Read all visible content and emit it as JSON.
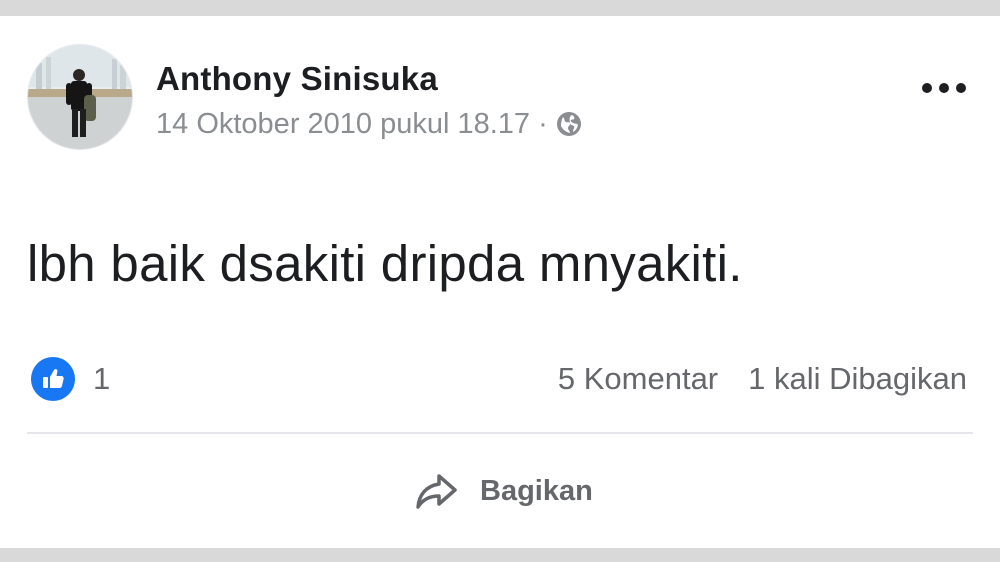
{
  "post": {
    "author": "Anthony Sinisuka",
    "date": "14 Oktober 2010 pukul 18.17",
    "separator": "·",
    "privacy_icon": "globe-icon",
    "text": "lbh baik dsakiti dripda mnyakiti."
  },
  "stats": {
    "reaction_icon": "like-icon",
    "reaction_count": "1",
    "comments": "5 Komentar",
    "shares": "1 kali Dibagikan"
  },
  "actions": {
    "share_icon": "share-arrow-icon",
    "share_label": "Bagikan"
  },
  "colors": {
    "accent": "#1877f2",
    "text_primary": "#1c1e21",
    "text_secondary": "#65676b",
    "meta_gray": "#8a8d91",
    "divider": "#e4e6eb",
    "page_bg": "#d9d9d9"
  }
}
